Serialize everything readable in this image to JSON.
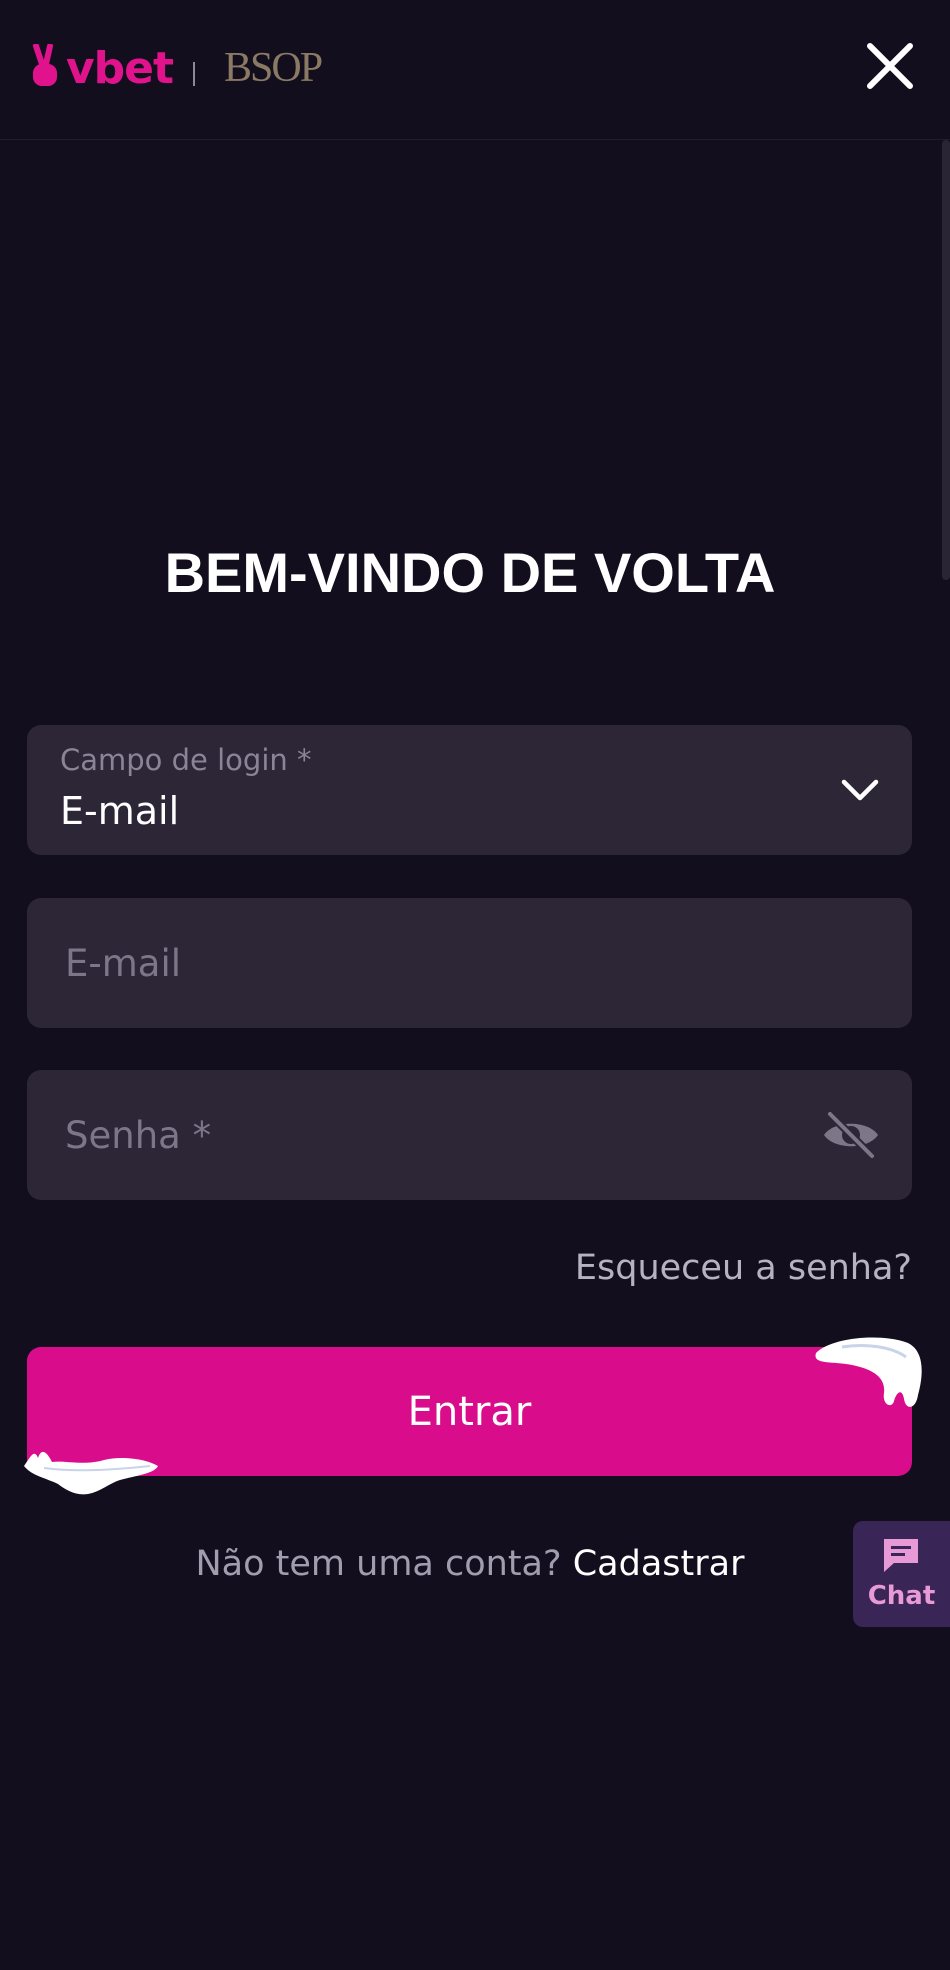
{
  "header": {
    "brand_primary": "vbet",
    "brand_secondary": "BSOP",
    "brand_color": "#e0138c",
    "close_icon": "close-icon"
  },
  "login": {
    "title": "BEM-VINDO DE VOLTA",
    "login_field": {
      "label": "Campo de login *",
      "value": "E-mail",
      "icon": "chevron-down-icon"
    },
    "email_field": {
      "placeholder": "E-mail",
      "value": ""
    },
    "password_field": {
      "placeholder": "Senha *",
      "value": "",
      "icon": "eye-off-icon"
    },
    "forgot_link": "Esqueceu a senha?",
    "submit_label": "Entrar",
    "submit_color": "#d90d8c",
    "signup_prompt": "Não tem uma conta?",
    "signup_link": "Cadastrar"
  },
  "chat": {
    "label": "Chat",
    "icon": "chat-icon"
  }
}
